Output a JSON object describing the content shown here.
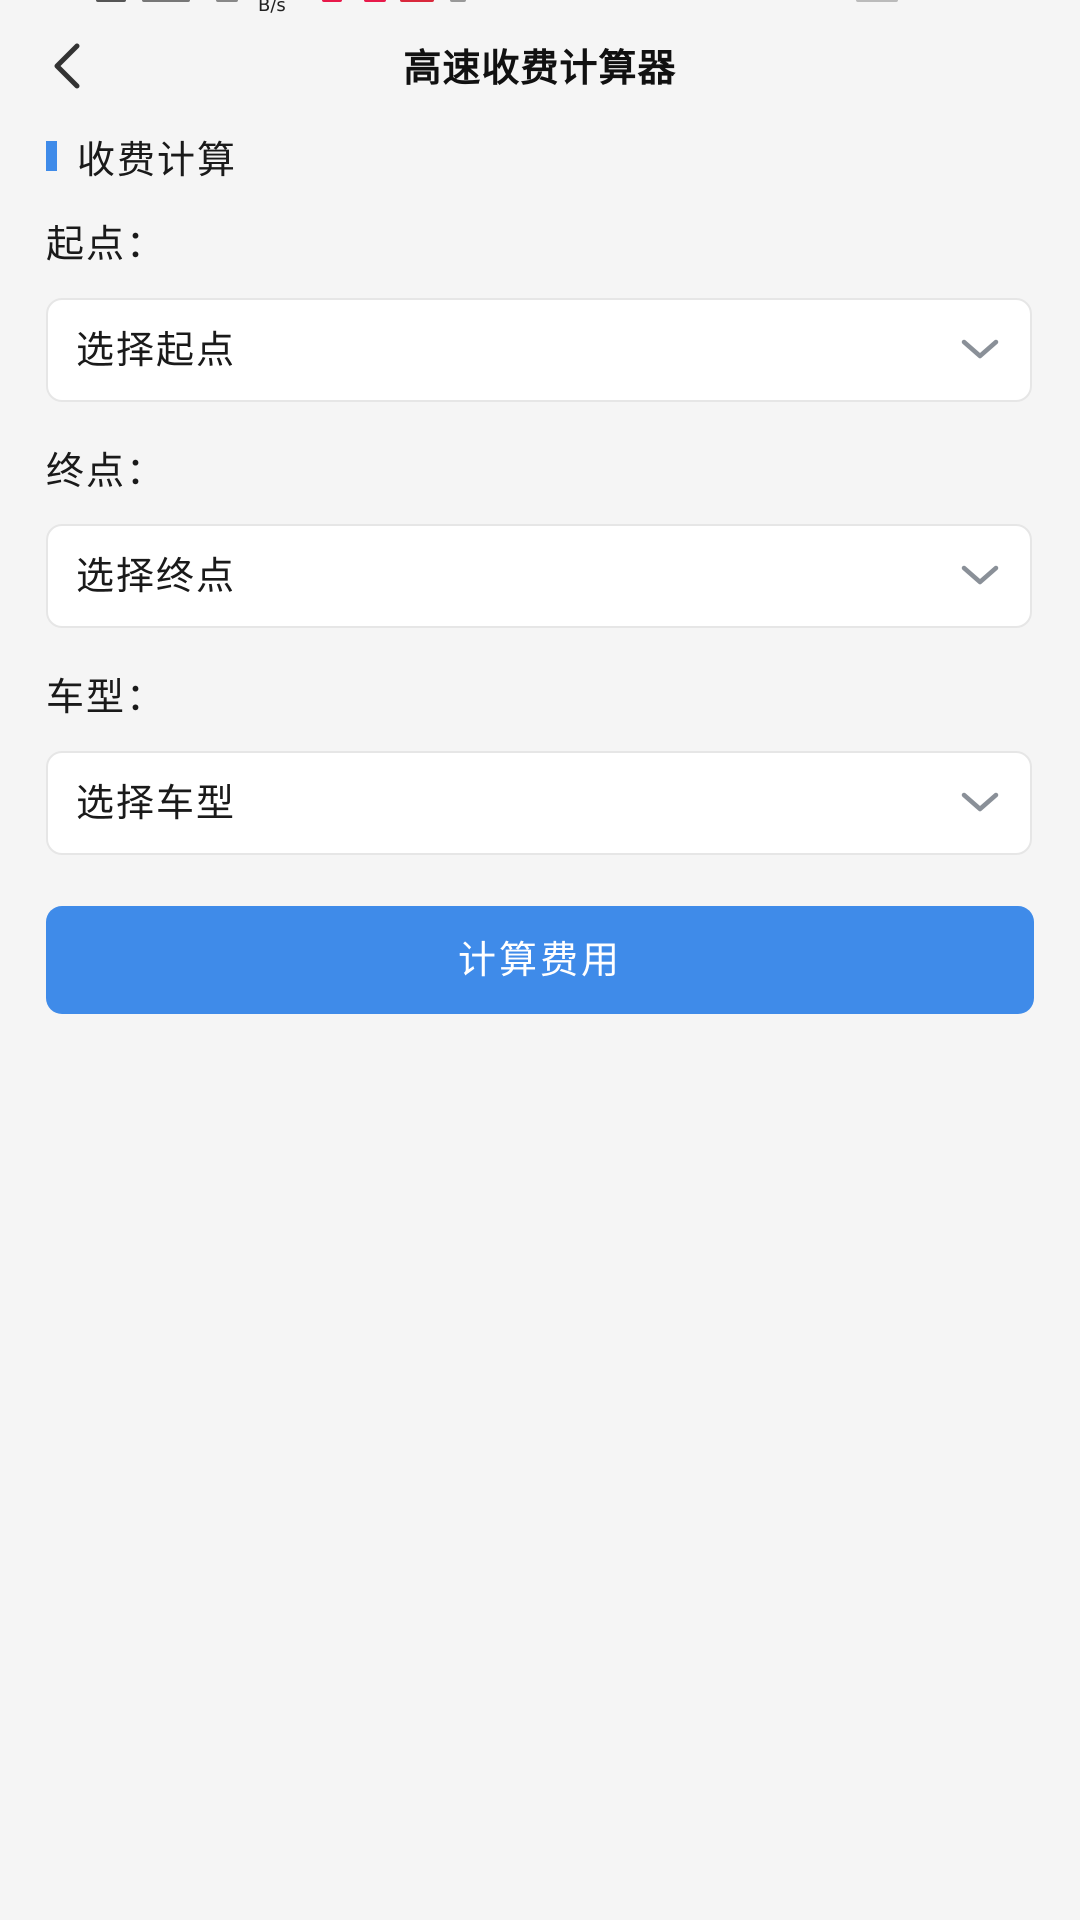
{
  "status_bar": {
    "net_speed": "B/s"
  },
  "app_bar": {
    "title": "高速收费计算器"
  },
  "section": {
    "title": "收费计算"
  },
  "form": {
    "start": {
      "label": "起点：",
      "placeholder": "选择起点"
    },
    "end": {
      "label": "终点：",
      "placeholder": "选择终点"
    },
    "vehicle": {
      "label": "车型：",
      "placeholder": "选择车型"
    }
  },
  "actions": {
    "calculate_label": "计算费用"
  },
  "colors": {
    "accent": "#3f8be9",
    "background": "#f5f5f5",
    "field_background": "#ffffff",
    "field_border": "#e6e6e6",
    "chevron": "#8a9098"
  },
  "icons": {
    "back": "chevron-left-icon",
    "dropdown": "chevron-down-icon"
  }
}
